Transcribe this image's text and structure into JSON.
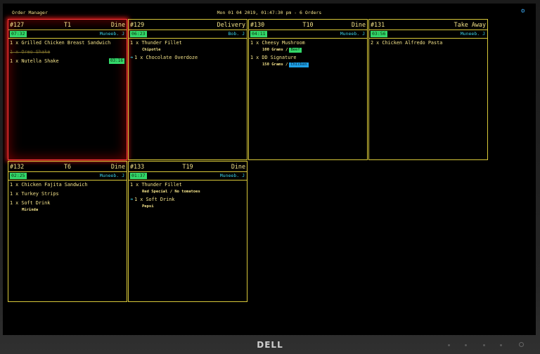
{
  "header": {
    "app_title": "Order Manager",
    "datetime": "Mon 01 04 2019, 01:47:30 pm - 6 Orders",
    "settings_icon": "gear-icon"
  },
  "brand": "DELL",
  "orders": [
    {
      "number": "#127",
      "table": "T1",
      "type": "Dine",
      "timer": "07:32",
      "server": "Muneeb. J",
      "alert": true,
      "items": [
        {
          "text": "1 x Grilled Chicken Breast Sandwich"
        },
        {
          "text": "1 x Oreo Shake",
          "done": true
        },
        {
          "text": "1 x Nutella Shake",
          "timer": "03:16"
        }
      ]
    },
    {
      "number": "#129",
      "table": "",
      "type": "Delivery",
      "timer": "06:23",
      "server": "Bob. J",
      "items": [
        {
          "text": "1 x Thunder Fillet",
          "mods": [
            "Chipotle"
          ]
        },
        {
          "text": "1 x Chocolate Overdoze",
          "arrow": true
        }
      ]
    },
    {
      "number": "#130",
      "table": "T10",
      "type": "Dine",
      "timer": "04:11",
      "server": "Muneeb. J",
      "items": [
        {
          "text": "1 x Cheesy Mushroom",
          "mod_main": "100 Grams  /",
          "tag": "Beef",
          "tag_class": "beef"
        },
        {
          "text": "1 x DD Signature",
          "mod_main": "150 Grams  /",
          "tag": "Chicken",
          "tag_class": "chicken"
        }
      ]
    },
    {
      "number": "#131",
      "table": "",
      "type": "Take Away",
      "timer": "03:56",
      "server": "Muneeb. J",
      "items": [
        {
          "text": "2 x Chicken Alfredo Pasta"
        }
      ]
    },
    {
      "number": "#132",
      "table": "T6",
      "type": "Dine",
      "timer": "02:25",
      "server": "Muneeb. J",
      "items": [
        {
          "text": "1 x Chicken Fajita Sandwich"
        },
        {
          "text": "1 x Turkey Strips"
        },
        {
          "text": "1 x Soft Drink",
          "mods": [
            "Mirinda"
          ]
        }
      ]
    },
    {
      "number": "#133",
      "table": "T19",
      "type": "Dine",
      "timer": "01:37",
      "server": "Muneeb. J",
      "items": [
        {
          "text": "1 x Thunder Fillet",
          "mod_main": "Red Special  / No tomatoes"
        },
        {
          "text": "1 x Soft Drink",
          "arrow": true,
          "mods": [
            "Pepsi"
          ]
        }
      ]
    }
  ]
}
